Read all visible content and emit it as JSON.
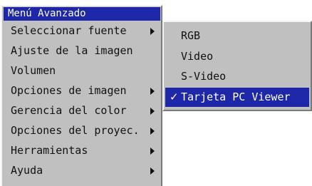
{
  "main_menu": {
    "title": "Menú Avanzado",
    "items": [
      {
        "label": "Seleccionar fuente",
        "has_submenu": true
      },
      {
        "label": "Ajuste de la imagen",
        "has_submenu": false
      },
      {
        "label": "Volumen",
        "has_submenu": false
      },
      {
        "label": "Opciones de imagen",
        "has_submenu": true
      },
      {
        "label": "Gerencia del color",
        "has_submenu": true
      },
      {
        "label": "Opciones del proyec.",
        "has_submenu": true
      },
      {
        "label": "Herramientas",
        "has_submenu": true
      },
      {
        "label": "Ayuda",
        "has_submenu": true
      }
    ]
  },
  "source_submenu": {
    "items": [
      {
        "label": "RGB",
        "selected": false
      },
      {
        "label": "Video",
        "selected": false
      },
      {
        "label": "S-Video",
        "selected": false
      },
      {
        "label": "Tarjeta PC Viewer",
        "selected": true
      }
    ],
    "check_icon": "checkmark-icon"
  },
  "colors": {
    "menu_background": "#c0c0c0",
    "highlight": "#1e27a8",
    "highlight_text": "#ffffff",
    "text": "#111111"
  }
}
